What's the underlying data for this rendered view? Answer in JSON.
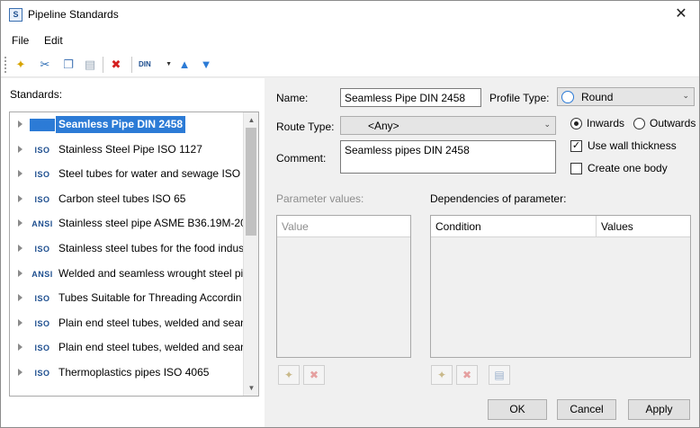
{
  "window": {
    "title": "Pipeline Standards",
    "icon": "app-icon",
    "close_glyph": "✕"
  },
  "menu": {
    "items": [
      {
        "label": "File"
      },
      {
        "label": "Edit"
      }
    ]
  },
  "toolbar": {
    "icons": [
      "new-standard-icon",
      "cut-icon",
      "copy-icon",
      "paste-icon",
      "delete-icon"
    ],
    "combo_label": "DIN",
    "up_glyph": "▲",
    "down_glyph": "▼"
  },
  "standards": {
    "label": "Standards:",
    "items": [
      {
        "badge": "DIN",
        "text": "Seamless Pipe DIN 2458",
        "selected": true
      },
      {
        "badge": "ISO",
        "text": "Stainless Steel Pipe ISO 1127"
      },
      {
        "badge": "ISO",
        "text": "Steel tubes for water and sewage ISO 5"
      },
      {
        "badge": "ISO",
        "text": "Carbon steel tubes ISO 65"
      },
      {
        "badge": "ANSI",
        "text": "Stainless steel pipe ASME B36.19M-200"
      },
      {
        "badge": "ISO",
        "text": "Stainless steel tubes for the food indus"
      },
      {
        "badge": "ANSI",
        "text": "Welded and seamless wrought steel pi"
      },
      {
        "badge": "ISO",
        "text": "Tubes Suitable for Threading Accordin"
      },
      {
        "badge": "ISO",
        "text": "Plain end steel tubes, welded and sean"
      },
      {
        "badge": "ISO",
        "text": "Plain end steel tubes, welded and sean"
      },
      {
        "badge": "ISO",
        "text": "Thermoplastics pipes ISO 4065"
      }
    ]
  },
  "form": {
    "name_label": "Name:",
    "name_value": "Seamless Pipe DIN 2458",
    "profile_type_label": "Profile Type:",
    "profile_type_value": "Round",
    "route_type_label": "Route Type:",
    "route_type_value": "<Any>",
    "comment_label": "Comment:",
    "comment_value": "Seamless pipes DIN 2458",
    "inwards_label": "Inwards",
    "inwards_checked": true,
    "outwards_label": "Outwards",
    "outwards_checked": false,
    "use_wall_thickness_label": "Use wall thickness",
    "use_wall_thickness_checked": true,
    "create_one_body_label": "Create one body",
    "create_one_body_checked": false
  },
  "parameter_values": {
    "label": "Parameter values:",
    "column": "Value"
  },
  "dependencies": {
    "label": "Dependencies of parameter:",
    "columns": [
      "Condition",
      "Values"
    ]
  },
  "buttons": {
    "ok": "OK",
    "cancel": "Cancel",
    "apply": "Apply"
  },
  "colors": {
    "selection": "#2c7bd6",
    "accent": "#1d4e8f"
  }
}
